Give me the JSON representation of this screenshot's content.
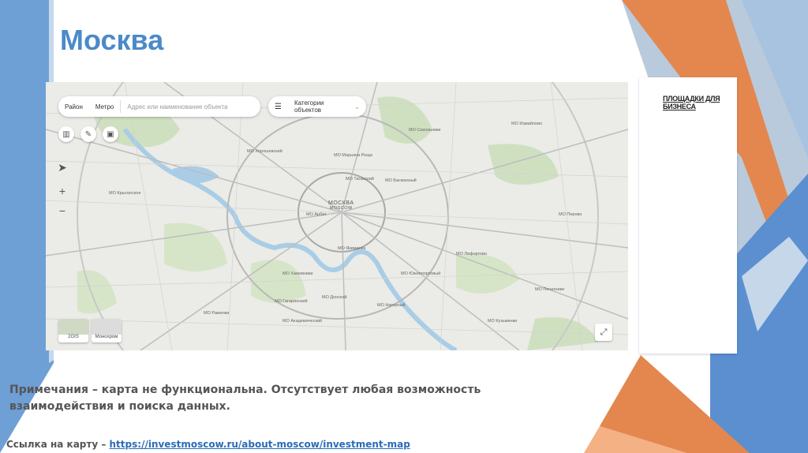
{
  "slide": {
    "title": "Москва",
    "notes": "Примечания – карта не функциональна. Отсутствует любая возможность взаимодействия и поиска данных.",
    "link_prefix": "Ссылка на карту – ",
    "link_text": "https://investmoscow.ru/about-moscow/investment-map"
  },
  "map": {
    "toolbar": {
      "tab_district": "Район",
      "tab_metro": "Метро",
      "search_placeholder": "Адрес или наименование объекта",
      "categories_label": "Категории объектов"
    },
    "center_label_ru": "МОСКВА",
    "center_label_en": "MOSCOW",
    "districts": [
      "МО Таганский",
      "МО Арбат",
      "МО Якиманка",
      "МО Басманный",
      "МО Хамовники",
      "МО Хорошевский",
      "МО Крылатское",
      "МО Сокольники",
      "МО Измайлово",
      "МО Перово",
      "МО Южнопортовый",
      "МО Академический",
      "МО Гагаринский",
      "МО Раменки",
      "МО Донской",
      "МО Марьина Роща",
      "МО Лефортово",
      "МО Кузьминки",
      "МО Печатники",
      "МО Нагорный"
    ],
    "zoom_in": "+",
    "zoom_out": "−",
    "layer_2gis": "2GIS",
    "layer_mono": "Монохром"
  },
  "side_panel": {
    "title": "ПЛОЩАДКИ ДЛЯ БИЗНЕСА"
  },
  "colors": {
    "accent_blue": "#4a8ac9",
    "orange": "#e3874f",
    "grey_blue": "#7f9fc0"
  }
}
